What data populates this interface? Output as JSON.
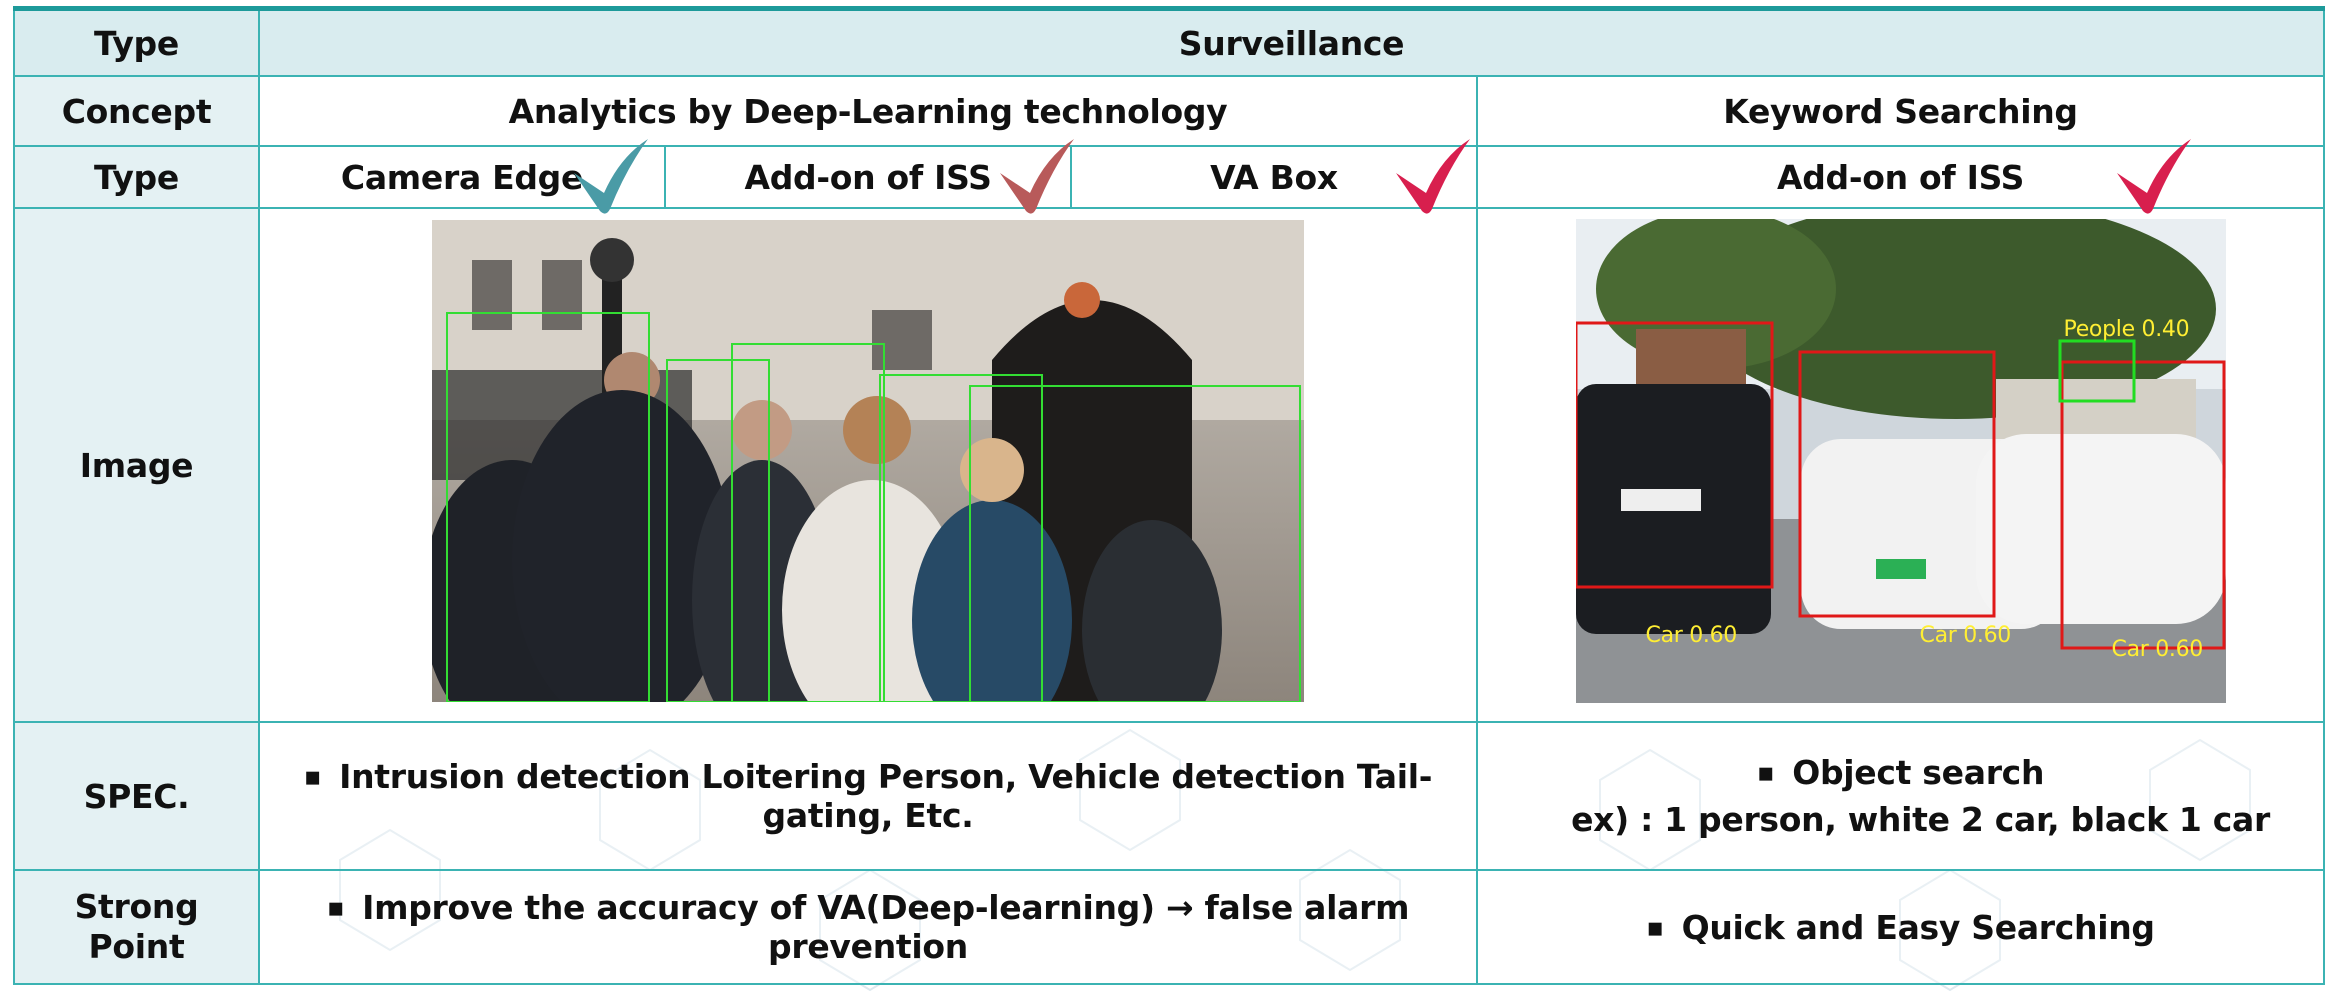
{
  "row_labels": {
    "type": "Type",
    "concept": "Concept",
    "type2": "Type",
    "image": "Image",
    "spec": "SPEC.",
    "strong_line1": "Strong",
    "strong_line2": "Point"
  },
  "header": {
    "surveillance": "Surveillance"
  },
  "concepts": {
    "analytics": "Analytics by  Deep-Learning technology",
    "keyword": "Keyword Searching"
  },
  "types": {
    "camera_edge": "Camera Edge",
    "addon_iss": "Add-on of ISS",
    "va_box": "VA Box",
    "addon_iss_2": "Add-on of ISS"
  },
  "checkmarks": {
    "camera_edge": "#4a9ba6",
    "addon_iss": "#b85a5a",
    "va_box": "#d81f4e",
    "addon_iss_2": "#d81f4e"
  },
  "detections": {
    "people_label": "People 0.40",
    "car1": "Car 0.60",
    "car2": "Car 0.60",
    "car3": "Car 0.60"
  },
  "spec": {
    "analytics": "Intrusion detection Loitering Person, Vehicle detection Tail-gating, Etc.",
    "keyword_line1": "Object search",
    "keyword_line2": "ex) : 1 person, white 2 car, black 1 car"
  },
  "strong_point": {
    "analytics": "Improve the accuracy of VA(Deep-learning) → false alarm prevention",
    "keyword": "Quick and Easy Searching"
  }
}
